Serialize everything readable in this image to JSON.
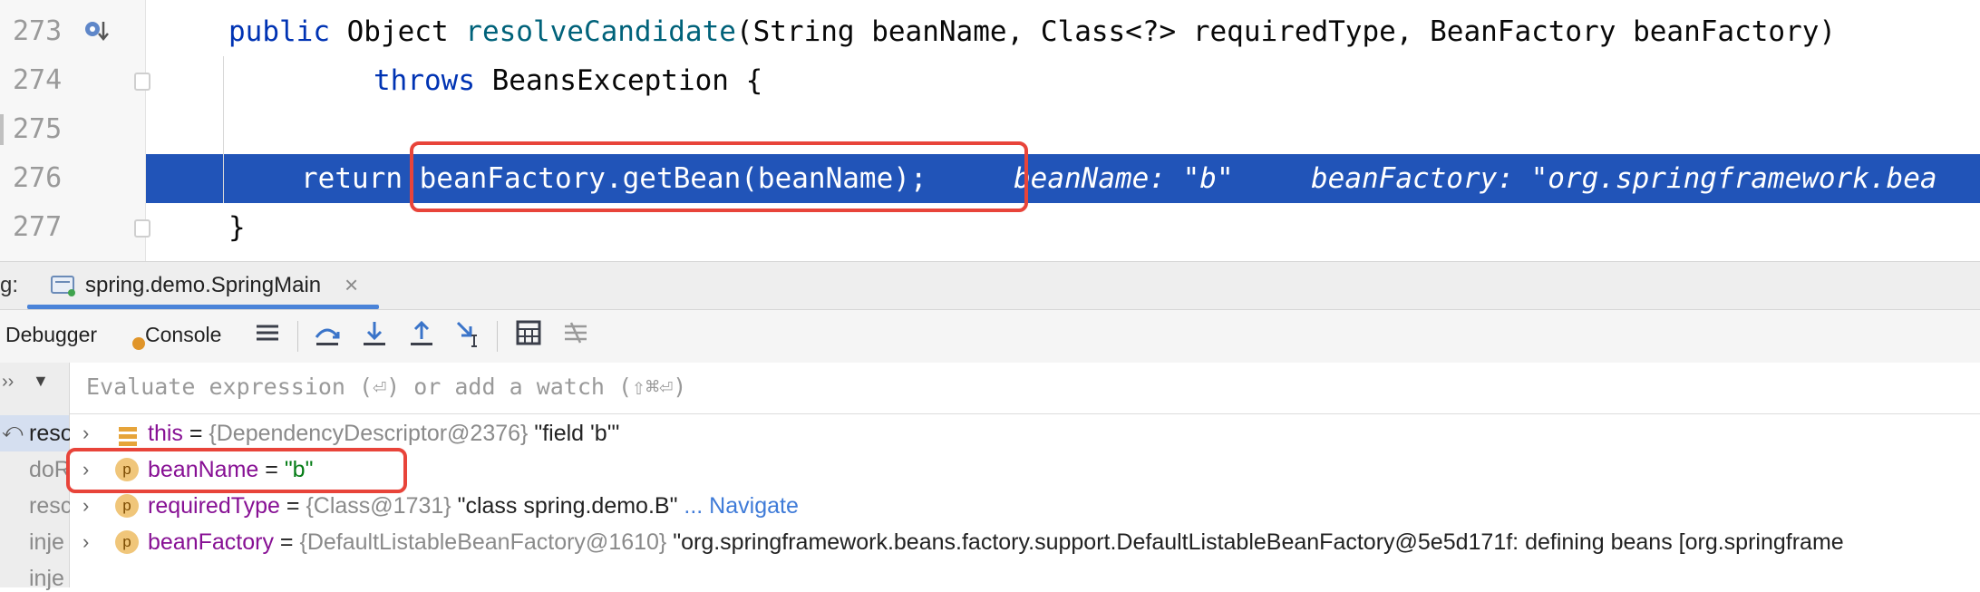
{
  "editor": {
    "lines": [
      {
        "num": "273",
        "kw": "public",
        "plain1": " Object ",
        "fn": "resolveCandidate",
        "plain2": "(String beanName, Class<?> requiredType, BeanFactory beanFactory)"
      },
      {
        "num": "274",
        "kw": "throws",
        "plain1": " BeansException {"
      },
      {
        "num": "275"
      },
      {
        "num": "276",
        "kw": "return",
        "plain1": " beanFactory.getBean(beanName);",
        "inlay1": "beanName: \"b\"",
        "inlay2": "beanFactory: \"org.springframework.bea"
      },
      {
        "num": "277",
        "plain1": "}"
      }
    ]
  },
  "session": {
    "prefix": "g:",
    "tab_label": "spring.demo.SpringMain",
    "close": "×"
  },
  "toolbar": {
    "debugger_label": "Debugger",
    "console_label": "Console"
  },
  "frames": {
    "items": [
      "reso",
      "doR",
      "resc",
      "inje",
      "inje"
    ]
  },
  "variables": {
    "eval_placeholder": "Evaluate expression (⏎) or add a watch (⇧⌘⏎)",
    "rows": [
      {
        "name": "this",
        "eq": " = ",
        "ref": "{DependencyDescriptor@2376}",
        "value": " \"field 'b'\""
      },
      {
        "name": "beanName",
        "eq": " = ",
        "value": "\"b\""
      },
      {
        "name": "requiredType",
        "eq": " = ",
        "ref": "{Class@1731}",
        "value": " \"class spring.demo.B\"",
        "nav": " ... Navigate"
      },
      {
        "name": "beanFactory",
        "eq": " = ",
        "ref": "{DefaultListableBeanFactory@1610}",
        "value": " \"org.springframework.beans.factory.support.DefaultListableBeanFactory@5e5d171f: defining beans [org.springframe"
      }
    ],
    "badge_letter": "p"
  },
  "colors": {
    "highlight": "#2154b8",
    "annotation_red": "#e8443a",
    "keyword": "#0033b3",
    "method": "#00627a"
  }
}
